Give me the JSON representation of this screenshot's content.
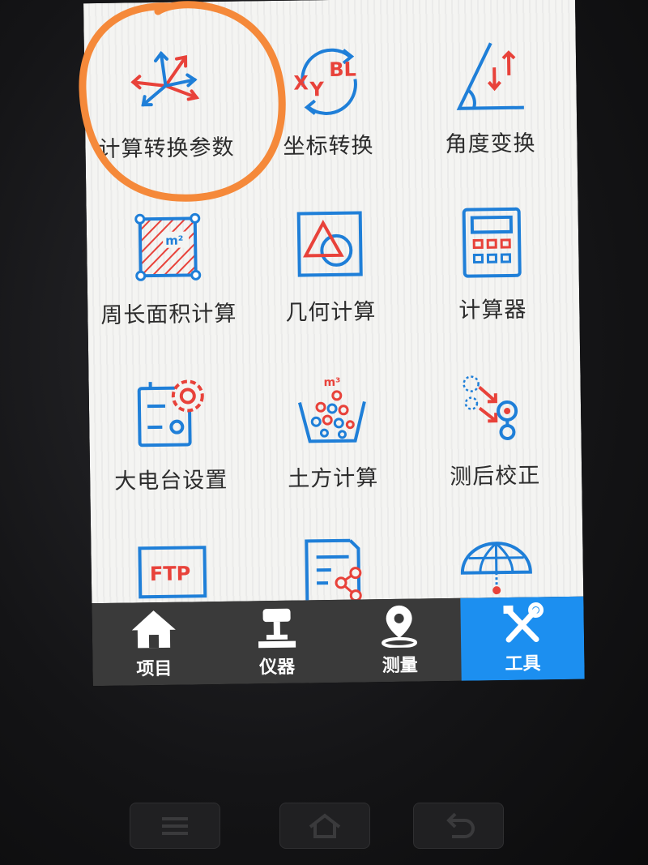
{
  "tools": [
    {
      "label": "计算转换参数",
      "icon": "axes-transform-icon"
    },
    {
      "label": "坐标转换",
      "icon": "xy-bl-convert-icon"
    },
    {
      "label": "角度变换",
      "icon": "angle-icon"
    },
    {
      "label": "周长面积计算",
      "icon": "area-calc-icon"
    },
    {
      "label": "几何计算",
      "icon": "geometry-icon"
    },
    {
      "label": "计算器",
      "icon": "calculator-icon"
    },
    {
      "label": "大电台设置",
      "icon": "radio-settings-icon"
    },
    {
      "label": "土方计算",
      "icon": "earthwork-icon"
    },
    {
      "label": "测后校正",
      "icon": "post-correction-icon"
    },
    {
      "label": "",
      "icon": "ftp-icon",
      "icon_text": "FTP"
    },
    {
      "label": "",
      "icon": "share-document-icon"
    },
    {
      "label": "",
      "icon": "globe-grid-icon"
    }
  ],
  "icon_text": {
    "xy_y": "Y",
    "xy_x": "X",
    "xy_bl": "BL",
    "area_unit": "m²",
    "volume_unit": "m³"
  },
  "tabbar": [
    {
      "label": "项目",
      "icon": "home-icon",
      "active": false
    },
    {
      "label": "仪器",
      "icon": "gnss-receiver-icon",
      "active": false
    },
    {
      "label": "测量",
      "icon": "location-pin-icon",
      "active": false
    },
    {
      "label": "工具",
      "icon": "tools-icon",
      "active": true
    }
  ],
  "colors": {
    "accent": "#1c8ff0",
    "icon_blue": "#1f7fd8",
    "icon_red": "#e8423a",
    "annotation": "#f5893a",
    "tabbar": "#3a3a3a"
  }
}
